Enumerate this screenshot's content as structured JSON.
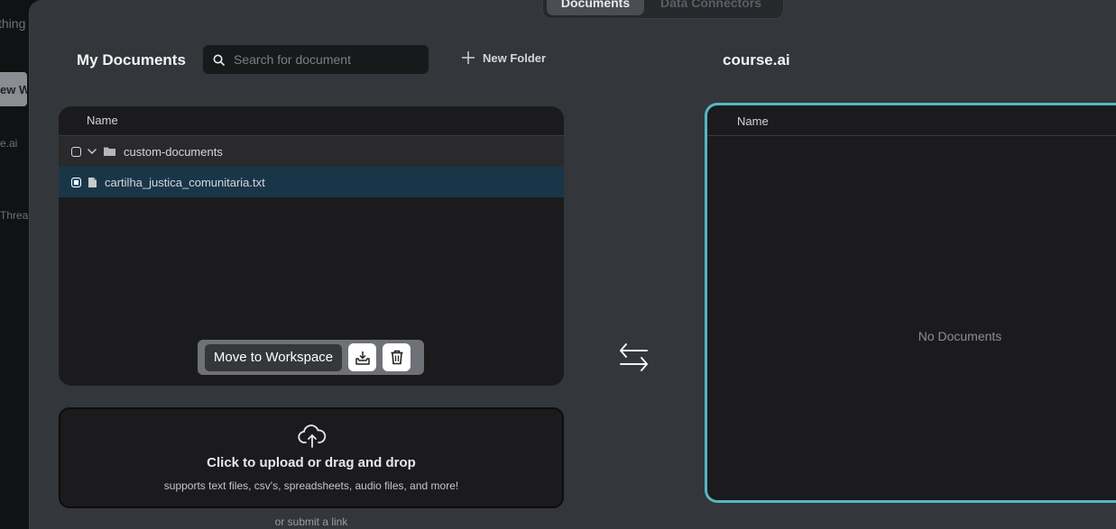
{
  "background": {
    "fragments": [
      "thing",
      "ew W",
      "e.ai",
      "Threa"
    ]
  },
  "tabs": [
    {
      "label": "Documents",
      "active": true
    },
    {
      "label": "Data Connectors",
      "active": false
    }
  ],
  "left": {
    "title": "My Documents",
    "search_placeholder": "Search for document",
    "new_folder_label": "New Folder",
    "column_name": "Name",
    "rows": [
      {
        "type": "folder",
        "label": "custom-documents",
        "checked": false
      },
      {
        "type": "file",
        "label": "cartilha_justica_comunitaria.txt",
        "checked": true
      }
    ],
    "move_button": "Move to Workspace"
  },
  "upload": {
    "title": "Click to upload or drag and drop",
    "subtitle": "supports text files, csv's, spreadsheets, audio files, and more!",
    "link_text": "or submit a link"
  },
  "right": {
    "title": "course.ai",
    "column_name": "Name",
    "empty_text": "No Documents"
  },
  "colors": {
    "accent": "#56b7c2",
    "selected_row": "#193649",
    "modal_bg": "#33363b"
  }
}
